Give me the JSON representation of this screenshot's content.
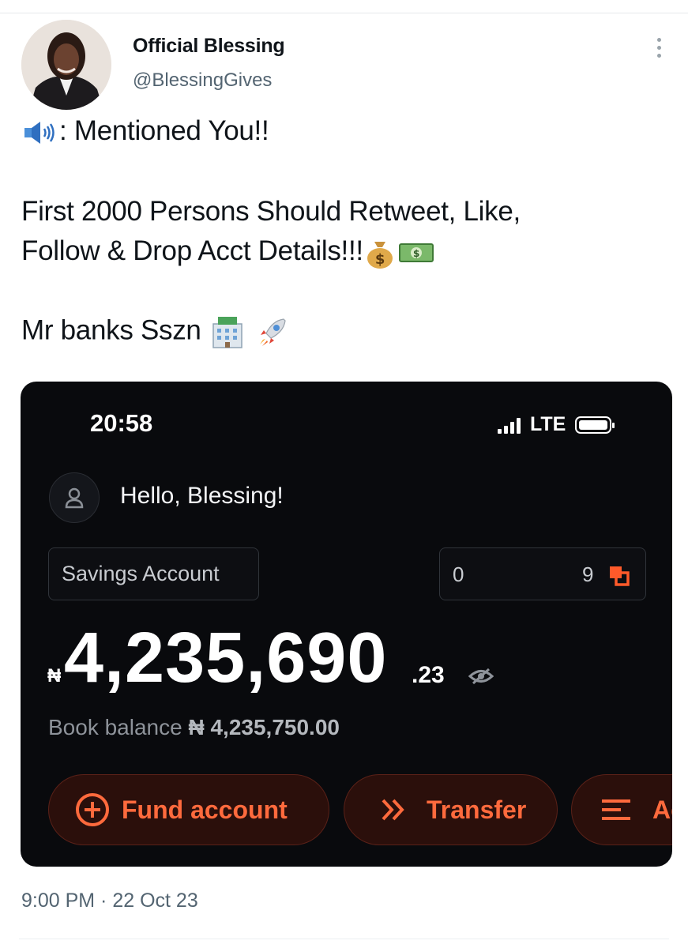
{
  "tweet": {
    "author_name": "Official Blessing",
    "author_handle": "@BlessingGives",
    "line1": ": Mentioned You!!",
    "line2": "First 2000 Persons Should Retweet, Like,",
    "line3": "Follow & Drop Acct Details!!!",
    "line4": "Mr banks Sszn",
    "timestamp": "9:00 PM · 22 Oct 23"
  },
  "phone": {
    "time": "20:58",
    "network": "LTE",
    "greeting": "Hello, Blessing!",
    "account_type": "Savings Account",
    "account_number_start": "0",
    "account_number_end": "9",
    "currency_symbol": "₦",
    "balance_main": "4,235,690",
    "balance_decimal": ".23",
    "book_balance_label": "Book balance",
    "book_balance_value": "₦ 4,235,750.00",
    "actions": {
      "fund": "Fund account",
      "transfer": "Transfer",
      "more": "Ac"
    }
  },
  "colors": {
    "accent": "#ff6a3d",
    "card_bg": "#090a0d",
    "handle": "#536471"
  },
  "icons": [
    "speaker-icon",
    "money-bag-icon",
    "dollar-bill-icon",
    "bank-icon",
    "rocket-icon",
    "user-icon",
    "copy-icon",
    "eye-icon",
    "plus-circle-icon",
    "double-chevron-icon",
    "list-icon"
  ]
}
